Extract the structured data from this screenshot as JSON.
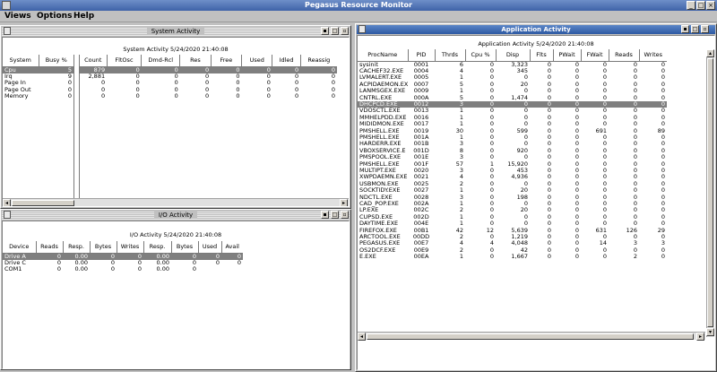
{
  "app": {
    "title": "Pegasus Resource Monitor"
  },
  "menu": {
    "views": "Views",
    "options": "Options",
    "help": "Help"
  },
  "title_buttons": {
    "minimize": "_",
    "maximize": "□",
    "close": "×"
  },
  "system": {
    "window_title": "System Activity",
    "heading": "System Activity 5/24/2020 21:40:08",
    "left_columns": [
      "System",
      "Busy %"
    ],
    "right_columns": [
      "Count",
      "FltOsc",
      "Dmd-Rcl",
      "Res",
      "Free",
      "Used",
      "Idled",
      "Reassig"
    ],
    "rows": [
      [
        "Cpu",
        "5",
        "879",
        "0",
        "0",
        "0",
        "0",
        "0",
        "0",
        "0"
      ],
      [
        "Irq",
        "9",
        "2,881",
        "0",
        "0",
        "0",
        "0",
        "0",
        "0",
        "0"
      ],
      [
        "Page In",
        "0",
        "0",
        "0",
        "0",
        "0",
        "0",
        "0",
        "0",
        "0"
      ],
      [
        "Page Out",
        "0",
        "0",
        "0",
        "0",
        "0",
        "0",
        "0",
        "0",
        "0"
      ],
      [
        "Memory",
        "0",
        "0",
        "0",
        "0",
        "0",
        "0",
        "0",
        "0",
        "0"
      ]
    ],
    "selected_row": 0
  },
  "io": {
    "window_title": "I/O Activity",
    "heading": "I/O Activity 5/24/2020 21:40:08",
    "columns": [
      "Device",
      "Reads",
      "Resp.",
      "Bytes",
      "Writes",
      "Resp.",
      "Bytes",
      "Used",
      "Avail"
    ],
    "rows": [
      [
        "Drive A",
        "0",
        "0.00",
        "0",
        "0",
        "0.00",
        "0",
        "0",
        "0"
      ],
      [
        "Drive C",
        "0",
        "0.00",
        "0",
        "0",
        "0.00",
        "0",
        "0",
        "0"
      ],
      [
        "COM1",
        "0",
        "0.00",
        "0",
        "0",
        "0.00",
        "0",
        "",
        ""
      ]
    ],
    "selected_row": 0
  },
  "apps": {
    "window_title": "Application Activity",
    "heading": "Application Activity 5/24/2020 21:40:08",
    "columns": [
      "ProcName",
      "PID",
      "Thrds",
      "Cpu %",
      "Disp",
      "Flts",
      "PWait",
      "FWait",
      "Reads",
      "Writes"
    ],
    "rows": [
      [
        "sysinit",
        "0001",
        "6",
        "0",
        "3,323",
        "0",
        "0",
        "0",
        "0",
        "0"
      ],
      [
        "CACHEF32.EXE",
        "0004",
        "4",
        "0",
        "345",
        "0",
        "0",
        "0",
        "0",
        "0"
      ],
      [
        "LVMALERT.EXE",
        "0005",
        "1",
        "0",
        "0",
        "0",
        "0",
        "0",
        "0",
        "0"
      ],
      [
        "ACPIDAEMON.EX",
        "0007",
        "5",
        "0",
        "20",
        "0",
        "0",
        "0",
        "0",
        "0"
      ],
      [
        "LANMSGEX.EXE",
        "0009",
        "1",
        "0",
        "0",
        "0",
        "0",
        "0",
        "0",
        "0"
      ],
      [
        "CNTRL.EXE",
        "000A",
        "5",
        "0",
        "1,474",
        "0",
        "0",
        "0",
        "0",
        "0"
      ],
      [
        "DHCPCD.EXE",
        "0012",
        "3",
        "0",
        "0",
        "0",
        "0",
        "0",
        "0",
        "0"
      ],
      [
        "VDOSCTL.EXE",
        "0013",
        "1",
        "0",
        "0",
        "0",
        "0",
        "0",
        "0",
        "0"
      ],
      [
        "MMHELPDD.EXE",
        "0016",
        "1",
        "0",
        "0",
        "0",
        "0",
        "0",
        "0",
        "0"
      ],
      [
        "MIDIDMON.EXE",
        "0017",
        "1",
        "0",
        "0",
        "0",
        "0",
        "0",
        "0",
        "0"
      ],
      [
        "PMSHELL.EXE",
        "0019",
        "30",
        "0",
        "599",
        "0",
        "0",
        "691",
        "0",
        "89"
      ],
      [
        "PMSHELL.EXE",
        "001A",
        "1",
        "0",
        "0",
        "0",
        "0",
        "0",
        "0",
        "0"
      ],
      [
        "HARDERR.EXE",
        "001B",
        "3",
        "0",
        "0",
        "0",
        "0",
        "0",
        "0",
        "0"
      ],
      [
        "VBOXSERVICE.E",
        "001D",
        "8",
        "0",
        "920",
        "0",
        "0",
        "0",
        "0",
        "0"
      ],
      [
        "PMSPOOL.EXE",
        "001E",
        "3",
        "0",
        "0",
        "0",
        "0",
        "0",
        "0",
        "0"
      ],
      [
        "PMSHELL.EXE",
        "001F",
        "57",
        "1",
        "15,920",
        "0",
        "0",
        "0",
        "0",
        "0"
      ],
      [
        "MULTIPT.EXE",
        "0020",
        "3",
        "0",
        "453",
        "0",
        "0",
        "0",
        "0",
        "0"
      ],
      [
        "XWPDAEMN.EXE",
        "0021",
        "4",
        "0",
        "4,936",
        "0",
        "0",
        "0",
        "0",
        "0"
      ],
      [
        "USBMON.EXE",
        "0025",
        "2",
        "0",
        "0",
        "0",
        "0",
        "0",
        "0",
        "0"
      ],
      [
        "SOCKTIDY.EXE",
        "0027",
        "1",
        "0",
        "20",
        "0",
        "0",
        "0",
        "0",
        "0"
      ],
      [
        "NDCTL.EXE",
        "0028",
        "3",
        "0",
        "198",
        "0",
        "0",
        "0",
        "0",
        "0"
      ],
      [
        "CAD_POP.EXE",
        "002A",
        "1",
        "0",
        "0",
        "0",
        "0",
        "0",
        "0",
        "0"
      ],
      [
        "LP.EXE",
        "002C",
        "2",
        "0",
        "20",
        "0",
        "0",
        "0",
        "0",
        "0"
      ],
      [
        "CUPSD.EXE",
        "002D",
        "1",
        "0",
        "0",
        "0",
        "0",
        "0",
        "0",
        "0"
      ],
      [
        "DAYTIME.EXE",
        "004E",
        "1",
        "0",
        "0",
        "0",
        "0",
        "0",
        "0",
        "0"
      ],
      [
        "FIREFOX.EXE",
        "00B1",
        "42",
        "12",
        "5,639",
        "0",
        "0",
        "631",
        "126",
        "29"
      ],
      [
        "ARCTOOL.EXE",
        "00DD",
        "2",
        "0",
        "1,219",
        "0",
        "0",
        "0",
        "0",
        "0"
      ],
      [
        "PEGASUS.EXE",
        "00E7",
        "4",
        "4",
        "4,048",
        "0",
        "0",
        "14",
        "3",
        "3"
      ],
      [
        "OS2DCF.EXE",
        "00E9",
        "2",
        "0",
        "42",
        "0",
        "0",
        "0",
        "0",
        "0"
      ],
      [
        "E.EXE",
        "00EA",
        "1",
        "0",
        "1,667",
        "0",
        "0",
        "0",
        "2",
        "0"
      ]
    ],
    "selected_row": 6
  },
  "colors": {
    "title_active": "#2e5aa2",
    "selection": "#7f7f7f",
    "background": "#c0c0c0"
  },
  "icons": [
    "app-icon",
    "window-icon",
    "minimize-icon",
    "maximize-icon",
    "close-icon",
    "scroll-arrow-icon"
  ]
}
